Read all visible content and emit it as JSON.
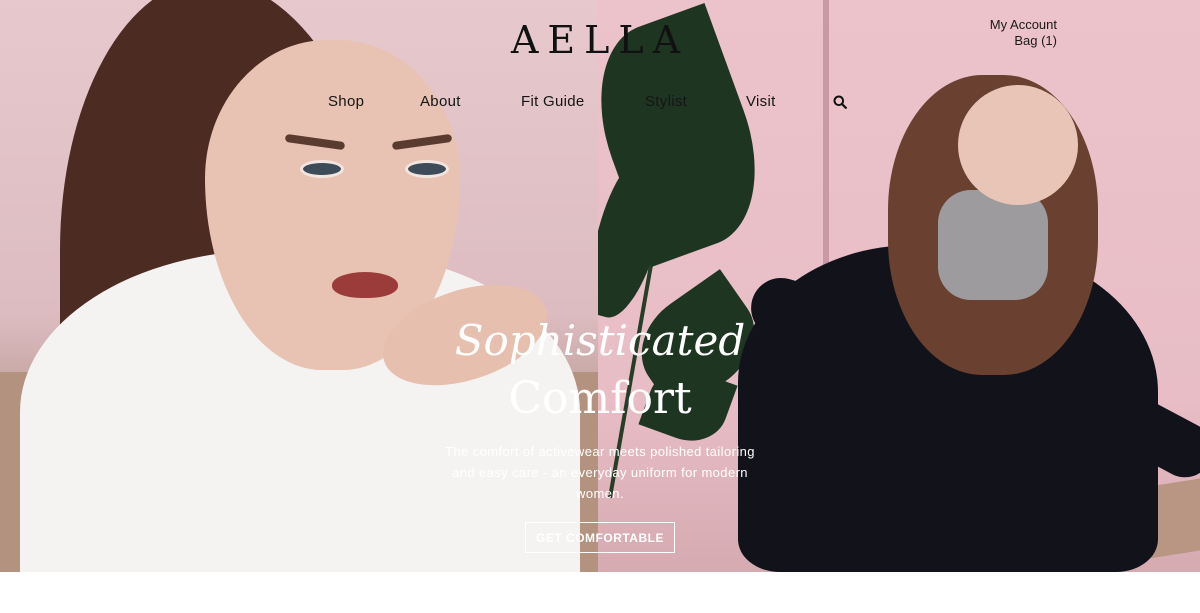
{
  "brand": {
    "logo": "AELLA"
  },
  "account": {
    "my_account": "My Account",
    "bag": "Bag (1)"
  },
  "nav": {
    "items": [
      {
        "label": "Shop"
      },
      {
        "label": "About"
      },
      {
        "label": "Fit Guide"
      },
      {
        "label": "Stylist"
      },
      {
        "label": "Visit"
      }
    ],
    "search_icon": "search-icon"
  },
  "hero": {
    "tagline": "Sophisticated",
    "headline": "Comfort",
    "description": "The comfort of activewear meets polished tailoring and easy care - an everyday uniform for modern women.",
    "cta": "GET COMFORTABLE"
  },
  "colors": {
    "text_dark": "#111111",
    "text_light": "#ffffff",
    "panel_left_pink": "#e7c9cd",
    "panel_right_pink": "#ecc3cb",
    "jacket": "#12131a"
  }
}
